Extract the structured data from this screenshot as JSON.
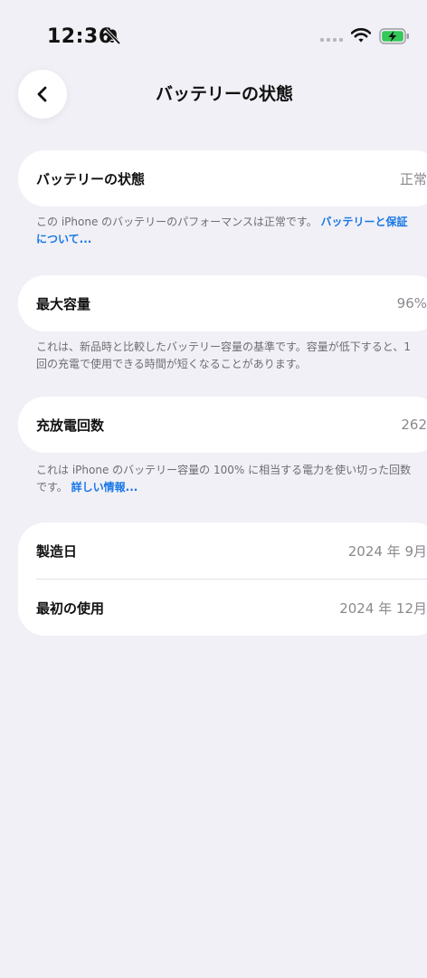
{
  "status_bar": {
    "time": "12:36"
  },
  "nav": {
    "title": "バッテリーの状態"
  },
  "battery_health": {
    "label": "バッテリーの状態",
    "value": "正常",
    "note": "この iPhone のバッテリーのパフォーマンスは正常です。",
    "note_link": "バッテリーと保証について..."
  },
  "max_capacity": {
    "label": "最大容量",
    "value": "96%",
    "note": "これは、新品時と比較したバッテリー容量の基準です。容量が低下すると、1回の充電で使用できる時間が短くなることがあります。"
  },
  "cycle_count": {
    "label": "充放電回数",
    "value": "262",
    "note": "これは iPhone のバッテリー容量の 100% に相当する電力を使い切った回数です。",
    "note_link": "詳しい情報..."
  },
  "dates": {
    "manufacture_label": "製造日",
    "manufacture_value": "2024 年 9月",
    "first_use_label": "最初の使用",
    "first_use_value": "2024 年 12月"
  },
  "colors": {
    "background": "#f1f0f6",
    "link": "#1877e6",
    "battery_fill": "#34c759"
  }
}
